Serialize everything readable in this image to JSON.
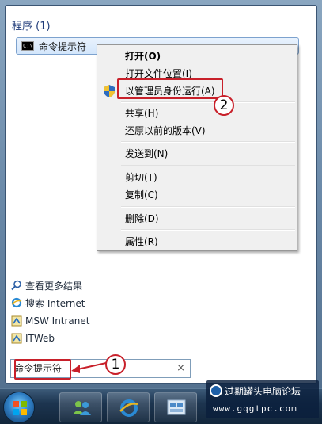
{
  "programs": {
    "header": "程序 (1)",
    "result": "命令提示符",
    "result_icon": "cmd-icon"
  },
  "context_menu": {
    "items": [
      {
        "label": "打开(O)",
        "bold": true
      },
      {
        "label": "打开文件位置(I)"
      },
      {
        "label": "以管理员身份运行(A)",
        "icon": "uac-shield-icon"
      },
      {
        "label": "共享(H)"
      },
      {
        "label": "还原以前的版本(V)"
      },
      {
        "label": "发送到(N)"
      },
      {
        "label": "剪切(T)"
      },
      {
        "label": "复制(C)"
      },
      {
        "label": "删除(D)"
      },
      {
        "label": "属性(R)"
      }
    ]
  },
  "links": [
    {
      "label": "查看更多结果",
      "icon": "search-icon"
    },
    {
      "label": "搜索 Internet",
      "icon": "ie-icon"
    },
    {
      "label": "MSW Intranet",
      "icon": "intranet-icon"
    },
    {
      "label": "ITWeb",
      "icon": "web-icon"
    }
  ],
  "search": {
    "value": "命令提示符",
    "clear": "×"
  },
  "callouts": [
    "1",
    "2"
  ],
  "watermark": {
    "title": "过期罐头电脑论坛",
    "url": "www.gqgtpc.com"
  },
  "colors": {
    "accent": "#c8202a",
    "selection": "#d3e6fb",
    "taskbar": "#1d3550"
  }
}
